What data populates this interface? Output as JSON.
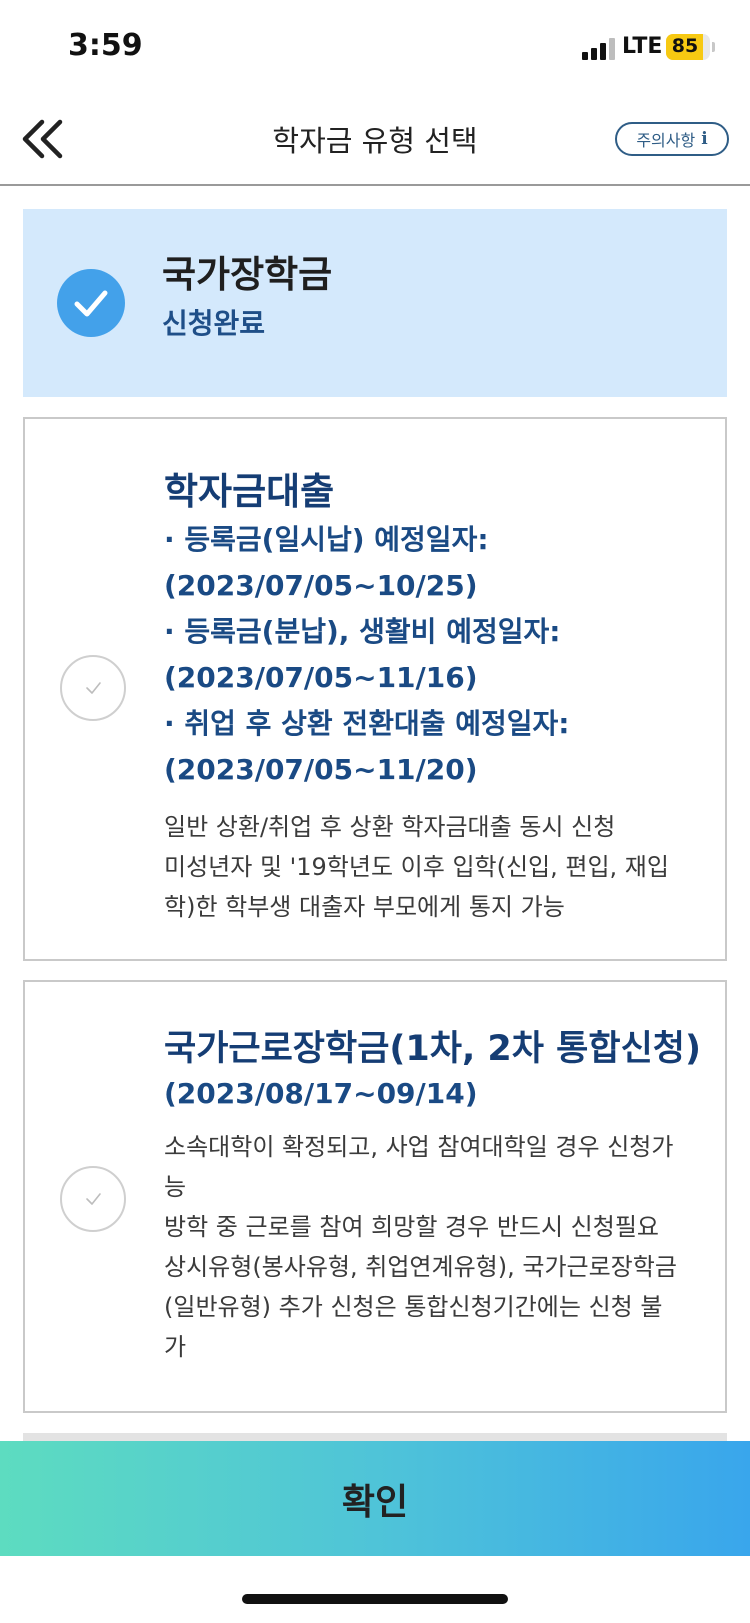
{
  "status_bar": {
    "time": "3:59",
    "network": "LTE",
    "battery": "85",
    "battery_level": 0.85
  },
  "header": {
    "title": "학자금 유형 선택",
    "notice_label": "주의사항",
    "notice_icon": "i"
  },
  "cards": [
    {
      "title": "국가장학금",
      "status": "신청완료",
      "selected": true
    },
    {
      "title": "학자금대출",
      "periods": [
        "· 등록금(일시납) 예정일자:",
        "(2023/07/05~10/25)",
        "· 등록금(분납), 생활비 예정일자:",
        "(2023/07/05~11/16)",
        "· 취업 후 상환 전환대출 예정일자:",
        "(2023/07/05~11/20)"
      ],
      "description": [
        "일반 상환/취업 후 상환 학자금대출 동시 신청",
        "미성년자 및 '19학년도 이후 입학(신입, 편입, 재입",
        "학)한 학부생 대출자 부모에게 통지 가능"
      ],
      "selected": false
    },
    {
      "title": "국가근로장학금(1차, 2차 통합신청)",
      "period": "(2023/08/17~09/14)",
      "description": [
        "소속대학이 확정되고, 사업 참여대학일 경우 신청가",
        "능",
        "방학 중 근로를 참여 희망할 경우 반드시 신청필요",
        "상시유형(봉사유형, 취업연계유형), 국가근로장학금",
        "(일반유형) 추가 신청은 통합신청기간에는 신청 불",
        "가"
      ],
      "selected": false
    }
  ],
  "footer": {
    "confirm_label": "확인"
  },
  "colors": {
    "selected_bg": "#d4e9fc",
    "check_blue": "#43a1ea",
    "navy_text": "#1f4f88",
    "gradient_start": "#5ddcc0",
    "gradient_end": "#39a6ec"
  },
  "icons": {
    "back": "double-chevron-left-icon",
    "check": "checkmark-icon",
    "info": "info-icon"
  }
}
